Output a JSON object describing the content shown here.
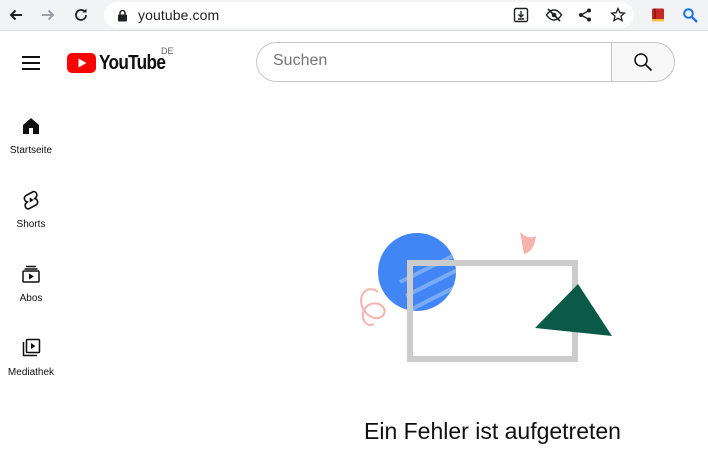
{
  "browser": {
    "url": "youtube.com"
  },
  "header": {
    "logo_text": "YouTube",
    "country_code": "DE",
    "search": {
      "placeholder": "Suchen",
      "value": ""
    }
  },
  "guide": {
    "items": [
      {
        "label": "Startseite",
        "icon": "home-icon"
      },
      {
        "label": "Shorts",
        "icon": "shorts-icon"
      },
      {
        "label": "Abos",
        "icon": "subscriptions-icon"
      },
      {
        "label": "Mediathek",
        "icon": "library-icon"
      }
    ]
  },
  "error": {
    "title": "Ein Fehler ist aufgetreten"
  },
  "colors": {
    "brand_red": "#ff0000",
    "illustration_blue": "#4285f4",
    "illustration_green": "#0b5a49",
    "illustration_pink": "#f4b3ae",
    "illustration_frame": "#cccccc"
  }
}
